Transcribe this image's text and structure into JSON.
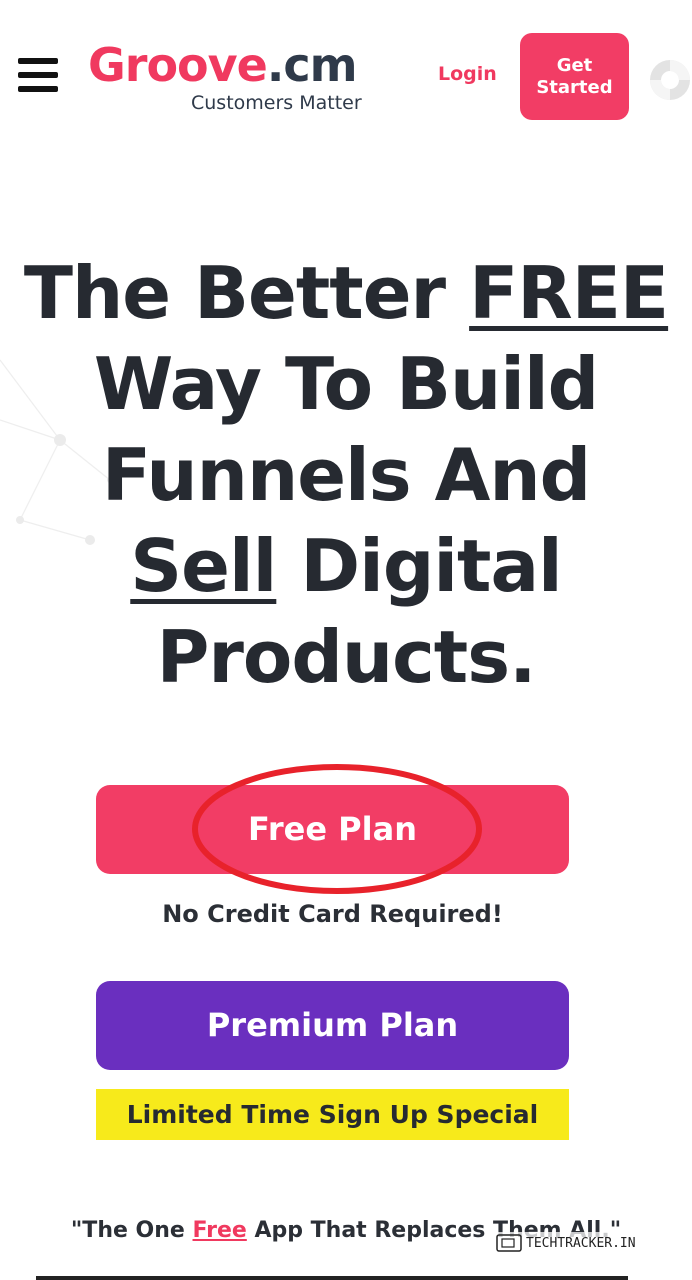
{
  "header": {
    "logo_brand": "Groove",
    "logo_tld": ".cm",
    "logo_tagline": "Customers Matter",
    "login_label": "Login",
    "get_started_label": "Get Started",
    "menu_icon": "hamburger-icon",
    "help_icon": "lifebuoy-icon"
  },
  "hero": {
    "line1_pre": "The Better ",
    "line1_ul": "FREE",
    "line2": "Way To Build",
    "line3": "Funnels And",
    "line4_ul": "Sell",
    "line4_post": " Digital",
    "line5": "Products."
  },
  "cta": {
    "free_plan_label": "Free Plan",
    "no_credit_card": "No Credit Card Required!",
    "premium_plan_label": "Premium Plan",
    "limited_time": "Limited Time Sign Up Special"
  },
  "quote": {
    "pre": "\"The One ",
    "free": "Free",
    "post": " App That Replaces Them All.\""
  },
  "watermark": {
    "text": "TECHTRACKER.IN"
  },
  "colors": {
    "brand_pink": "#f23d65",
    "premium_purple": "#6a2fbf",
    "banner_yellow": "#f7ea1b",
    "heading_dark": "#262a31"
  }
}
